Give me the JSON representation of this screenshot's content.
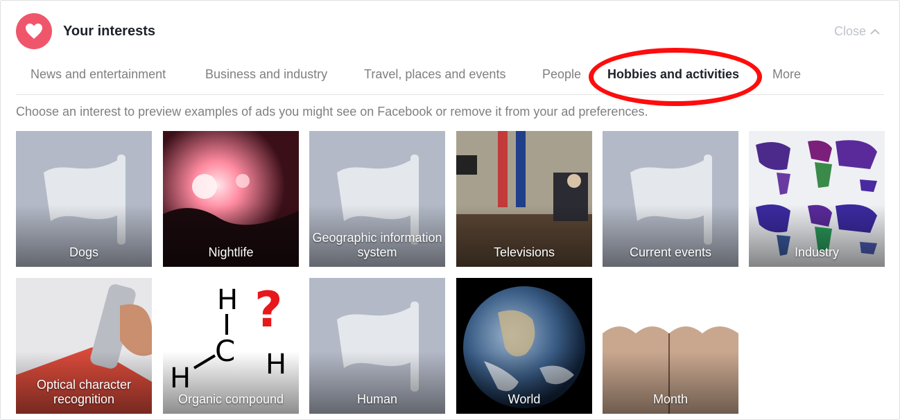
{
  "header": {
    "title": "Your interests",
    "close_label": "Close"
  },
  "tabs": [
    {
      "label": "News and entertainment"
    },
    {
      "label": "Business and industry"
    },
    {
      "label": "Travel, places and events"
    },
    {
      "label": "People"
    },
    {
      "label": "Hobbies and activities",
      "active": true
    },
    {
      "label": "More"
    }
  ],
  "hint": "Choose an interest to preview examples of ads you might see on Facebook or remove it from your ad preferences.",
  "interests": [
    {
      "label": "Dogs",
      "image": "placeholder-flag"
    },
    {
      "label": "Nightlife",
      "image": "concert-crowd-photo"
    },
    {
      "label": "Geographic information system",
      "image": "placeholder-flag"
    },
    {
      "label": "Televisions",
      "image": "office-desk-photo"
    },
    {
      "label": "Current events",
      "image": "placeholder-flag"
    },
    {
      "label": "Industry",
      "image": "world-map-graphic"
    },
    {
      "label": "Optical character recognition",
      "image": "scanner-pen-photo"
    },
    {
      "label": "Organic compound",
      "image": "methane-structure-drawing"
    },
    {
      "label": "Human",
      "image": "placeholder-flag"
    },
    {
      "label": "World",
      "image": "earth-photo"
    },
    {
      "label": "Month",
      "image": "knuckle-months-drawing"
    }
  ],
  "colors": {
    "accent_red": "#f0566b",
    "highlight_ring": "#ff0c0c",
    "placeholder_tile": "#b3b9c7",
    "muted_text": "#7f7f7f"
  }
}
